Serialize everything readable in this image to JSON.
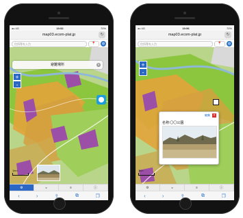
{
  "status": {
    "carrier": "au 4G",
    "time_left": "19:52",
    "time_right": "19:56",
    "battery": "70%"
  },
  "browser": {
    "url": "map03.ecom-plat.jp",
    "reload_icon": "reload-icon",
    "search_placeholder": "住所等を入力",
    "pin_label": "📍",
    "globe_icon": "globe-icon"
  },
  "left_screen": {
    "legend_title": "避難場所",
    "legend_close": "v",
    "zoom_in": "+",
    "zoom_out": "-",
    "location_icon": "location-pin-icon",
    "scale": "1km"
  },
  "right_screen": {
    "zoom_in": "+",
    "zoom_out": "-",
    "popup_edit": "編集",
    "popup_close": "×",
    "popup_name": "名称:〇〇公園",
    "scale": "1km"
  },
  "tabs": {
    "items": [
      {
        "label": "⚙",
        "icon": "layers-icon"
      },
      {
        "label": "◒",
        "icon": "basemap-icon"
      },
      {
        "label": "≡",
        "icon": "list-icon"
      },
      {
        "label": "ⓘ",
        "icon": "info-icon"
      }
    ]
  },
  "safari_toolbar": {
    "items": [
      {
        "label": "‹",
        "icon": "back-icon"
      },
      {
        "label": "›",
        "icon": "forward-icon"
      },
      {
        "label": "⇪",
        "icon": "share-icon"
      },
      {
        "label": "⧉",
        "icon": "bookmarks-icon"
      },
      {
        "label": "❐",
        "icon": "tabs-icon"
      }
    ]
  },
  "colors": {
    "map_green": "#8cc63f",
    "map_orange": "#e2a33a",
    "map_purple": "#9b4fa6",
    "map_river": "#8fb8d8",
    "accent_blue": "#2b67c4"
  }
}
